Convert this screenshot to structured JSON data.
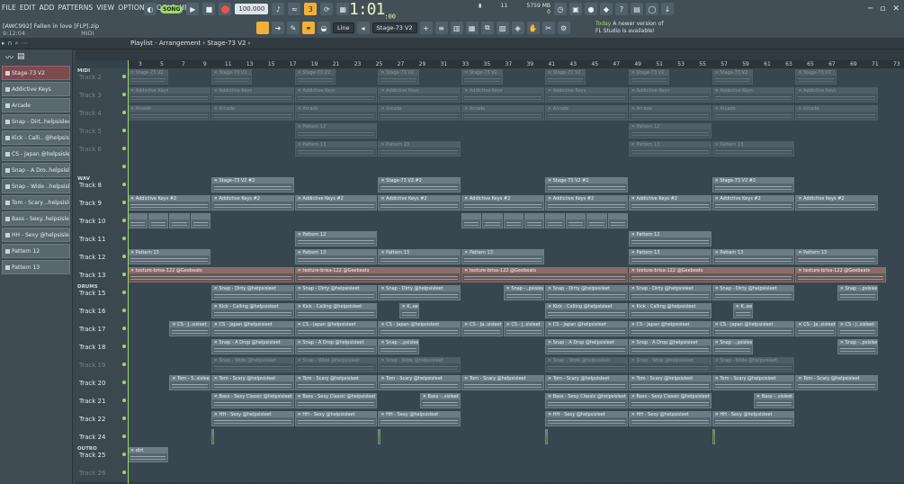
{
  "menu": [
    "FILE",
    "EDIT",
    "ADD",
    "PATTERNS",
    "VIEW",
    "OPTIONS",
    "TOOLS",
    "HELP"
  ],
  "project": {
    "name": "[AWC992] Fallen in love [FLP].zip",
    "time": "9:12:04",
    "midi": "MIDI"
  },
  "transport": {
    "song_label": "SONG",
    "tempo": "100.000",
    "clock": "1:01",
    "clock_sub": ":00"
  },
  "cpu": {
    "voices": "11",
    "mem": "5759 MB",
    "zero": "0"
  },
  "news": {
    "day": "Today",
    "line1": "A newer version of",
    "line2": "FL Studio is available!"
  },
  "snap": {
    "mode": "Line",
    "pattern": "Stage-73 V2"
  },
  "breadcrumb": "Playlist - Arrangement › Stage-73 V2 ›",
  "browser": {
    "header_icon": "wave-icon",
    "items": [
      {
        "label": "Stage-73 V2",
        "selected": true
      },
      {
        "label": "Addictive Keys",
        "selected": false
      },
      {
        "label": "Arcade",
        "selected": false
      },
      {
        "label": "Snap - Dirt..helpsisleet",
        "selected": false
      },
      {
        "label": "Kick - Calli.. @helpsisleet",
        "selected": false
      },
      {
        "label": "CS - Japan @helpsisleet",
        "selected": false
      },
      {
        "label": "Snap - A Dro..helpsisleet",
        "selected": false
      },
      {
        "label": "Snap - Wide ..helpsisleet",
        "selected": false
      },
      {
        "label": "Tom - Scary ..helpsisleet",
        "selected": false
      },
      {
        "label": "Bass - Sexy..helpsisleet",
        "selected": false
      },
      {
        "label": "HH - Sexy @helpsisleet",
        "selected": false
      },
      {
        "label": "Pattern 12",
        "selected": false
      },
      {
        "label": "Pattern 13",
        "selected": false
      }
    ]
  },
  "ruler": [
    "3",
    "5",
    "7",
    "9",
    "11",
    "13",
    "15",
    "17",
    "19",
    "21",
    "23",
    "25",
    "27",
    "29",
    "31",
    "33",
    "35",
    "37",
    "39",
    "41",
    "43",
    "45",
    "47",
    "49",
    "51",
    "53",
    "55",
    "57",
    "59",
    "61",
    "63",
    "65",
    "67",
    "69",
    "71",
    "73"
  ],
  "groups": [
    {
      "label": "MIDI",
      "row": 0
    },
    {
      "label": "WAV",
      "row": 6
    },
    {
      "label": "DRUMS",
      "row": 12
    },
    {
      "label": "OUTRO",
      "row": 21
    }
  ],
  "tracks": [
    {
      "name": "Track 2",
      "dim": true,
      "clips": [
        {
          "s": 0,
          "e": 1,
          "n": "Stage-73 V2"
        },
        {
          "s": 2,
          "e": 3,
          "n": "Stage-73 V2"
        },
        {
          "s": 4,
          "e": 5,
          "n": "Stage-73 V2"
        },
        {
          "s": 6,
          "e": 7,
          "n": "Stage-73 V2"
        },
        {
          "s": 8,
          "e": 9,
          "n": "Stage-73 V2"
        },
        {
          "s": 10,
          "e": 11,
          "n": "Stage-73 V2"
        },
        {
          "s": 12,
          "e": 13,
          "n": "Stage-73 V2"
        },
        {
          "s": 14,
          "e": 15,
          "n": "Stage-73 V2"
        },
        {
          "s": 16,
          "e": 17,
          "n": "Stage-73 V2"
        }
      ]
    },
    {
      "name": "Track 3",
      "dim": true,
      "clips": [
        {
          "s": 0,
          "e": 2,
          "n": "Addictive Keys"
        },
        {
          "s": 2,
          "e": 4,
          "n": "Addictive Keys"
        },
        {
          "s": 4,
          "e": 6,
          "n": "Addictive Keys"
        },
        {
          "s": 6,
          "e": 8,
          "n": "Addictive Keys"
        },
        {
          "s": 8,
          "e": 10,
          "n": "Addictive Keys"
        },
        {
          "s": 10,
          "e": 12,
          "n": "Addictive Keys"
        },
        {
          "s": 12,
          "e": 14,
          "n": "Addictive Keys"
        },
        {
          "s": 14,
          "e": 16,
          "n": "Addictive Keys"
        },
        {
          "s": 16,
          "e": 18,
          "n": "Addictive Keys"
        }
      ]
    },
    {
      "name": "Track 4",
      "dim": true,
      "clips": [
        {
          "s": 0,
          "e": 2,
          "n": "Arcade"
        },
        {
          "s": 2,
          "e": 4,
          "n": "Arcade"
        },
        {
          "s": 4,
          "e": 6,
          "n": "Arcade"
        },
        {
          "s": 6,
          "e": 8,
          "n": "Arcade"
        },
        {
          "s": 8,
          "e": 10,
          "n": "Arcade"
        },
        {
          "s": 10,
          "e": 12,
          "n": "Arcade"
        },
        {
          "s": 12,
          "e": 14,
          "n": "Arcade"
        },
        {
          "s": 14,
          "e": 16,
          "n": "Arcade"
        },
        {
          "s": 16,
          "e": 18,
          "n": "Arcade"
        }
      ]
    },
    {
      "name": "Track 5",
      "dim": true,
      "clips": [
        {
          "s": 4,
          "e": 6,
          "n": "Pattern 12"
        },
        {
          "s": 12,
          "e": 14,
          "n": "Pattern 12"
        }
      ]
    },
    {
      "name": "Track 6",
      "dim": true,
      "clips": [
        {
          "s": 4,
          "e": 6,
          "n": "Pattern 13"
        },
        {
          "s": 6,
          "e": 8,
          "n": "Pattern 13"
        },
        {
          "s": 12,
          "e": 14,
          "n": "Pattern 13"
        },
        {
          "s": 14,
          "e": 16,
          "n": "Pattern 13"
        }
      ]
    },
    {
      "name": "",
      "dim": true,
      "clips": []
    },
    {
      "name": "Track 8",
      "dim": false,
      "clips": [
        {
          "s": 2,
          "e": 4,
          "n": "Stage-73 V2 #2"
        },
        {
          "s": 6,
          "e": 8,
          "n": "Stage-73 V2 #2"
        },
        {
          "s": 10,
          "e": 12,
          "n": "Stage-73 V2 #2"
        },
        {
          "s": 14,
          "e": 16,
          "n": "Stage-73 V2 #2"
        }
      ]
    },
    {
      "name": "Track 9",
      "dim": false,
      "clips": [
        {
          "s": 0,
          "e": 2,
          "n": "Addictive Keys #2"
        },
        {
          "s": 2,
          "e": 4,
          "n": "Addictive Keys #2"
        },
        {
          "s": 4,
          "e": 6,
          "n": "Addictive Keys #2"
        },
        {
          "s": 6,
          "e": 8,
          "n": "Addictive Keys #2"
        },
        {
          "s": 8,
          "e": 10,
          "n": "Addictive Keys #2"
        },
        {
          "s": 10,
          "e": 12,
          "n": "Addictive Keys #2"
        },
        {
          "s": 12,
          "e": 14,
          "n": "Addictive Keys #2"
        },
        {
          "s": 14,
          "e": 16,
          "n": "Addictive Keys #2"
        },
        {
          "s": 16,
          "e": 18,
          "n": "Addictive Keys #2"
        }
      ]
    },
    {
      "name": "Track 10",
      "dim": false,
      "clips": [
        {
          "s": 0,
          "e": 0.5,
          "n": ""
        },
        {
          "s": 0.5,
          "e": 1,
          "n": ""
        },
        {
          "s": 1,
          "e": 1.5,
          "n": ""
        },
        {
          "s": 1.5,
          "e": 2,
          "n": ""
        },
        {
          "s": 8,
          "e": 8.5,
          "n": ""
        },
        {
          "s": 8.5,
          "e": 9,
          "n": ""
        },
        {
          "s": 9,
          "e": 9.5,
          "n": ""
        },
        {
          "s": 9.5,
          "e": 10,
          "n": ""
        },
        {
          "s": 10,
          "e": 10.5,
          "n": ""
        },
        {
          "s": 10.5,
          "e": 11,
          "n": ""
        },
        {
          "s": 11,
          "e": 11.5,
          "n": ""
        },
        {
          "s": 11.5,
          "e": 12,
          "n": ""
        }
      ]
    },
    {
      "name": "Track 11",
      "dim": false,
      "clips": [
        {
          "s": 4,
          "e": 6,
          "n": "Pattern 12"
        },
        {
          "s": 12,
          "e": 14,
          "n": "Pattern 12"
        }
      ]
    },
    {
      "name": "Track 12",
      "dim": false,
      "clips": [
        {
          "s": 0,
          "e": 2,
          "n": "Pattern 13"
        },
        {
          "s": 4,
          "e": 6,
          "n": "Pattern 13"
        },
        {
          "s": 6,
          "e": 8,
          "n": "Pattern 13"
        },
        {
          "s": 8,
          "e": 10,
          "n": "Pattern 13"
        },
        {
          "s": 12,
          "e": 14,
          "n": "Pattern 13"
        },
        {
          "s": 14,
          "e": 16,
          "n": "Pattern 13"
        },
        {
          "s": 16,
          "e": 18,
          "n": "Pattern 13"
        }
      ]
    },
    {
      "name": "Track 13",
      "dim": false,
      "clips": [
        {
          "s": 0,
          "e": 4,
          "n": "texture-brisa-122 @Geebeats",
          "c": "brown"
        },
        {
          "s": 4,
          "e": 8,
          "n": "texture-brisa-122 @Geebeats",
          "c": "brown"
        },
        {
          "s": 8,
          "e": 12,
          "n": "texture-brisa-122 @Geebeats",
          "c": "brown"
        },
        {
          "s": 12,
          "e": 16,
          "n": "texture-brisa-122 @Geebeats",
          "c": "brown"
        },
        {
          "s": 16,
          "e": 18.2,
          "n": "texture-brisa-122 @Geebeats",
          "c": "brown"
        }
      ]
    },
    {
      "name": "Track 15",
      "dim": false,
      "clips": [
        {
          "s": 2,
          "e": 4,
          "n": "Snap - Dirty @helpsisleet"
        },
        {
          "s": 4,
          "e": 6,
          "n": "Snap - Dirty @helpsisleet"
        },
        {
          "s": 6,
          "e": 8,
          "n": "Snap - Dirty @helpsisleet"
        },
        {
          "s": 9,
          "e": 10,
          "n": "Snap -..psisleet"
        },
        {
          "s": 10,
          "e": 12,
          "n": "Snap - Dirty @helpsisleet"
        },
        {
          "s": 12,
          "e": 14,
          "n": "Snap - Dirty @helpsisleet"
        },
        {
          "s": 14,
          "e": 16,
          "n": "Snap - Dirty @helpsisleet"
        },
        {
          "s": 17,
          "e": 18,
          "n": "Snap -..psisleet"
        }
      ]
    },
    {
      "name": "Track 16",
      "dim": false,
      "clips": [
        {
          "s": 2,
          "e": 4,
          "n": "Kick - Calling @helpsisleet"
        },
        {
          "s": 4,
          "e": 6,
          "n": "Kick - Calling @helpsisleet"
        },
        {
          "s": 6.5,
          "e": 7,
          "n": "K..eet"
        },
        {
          "s": 10,
          "e": 12,
          "n": "Kick - Calling @helpsisleet"
        },
        {
          "s": 12,
          "e": 14,
          "n": "Kick - Calling @helpsisleet"
        },
        {
          "s": 14.5,
          "e": 15,
          "n": "K..eet"
        }
      ]
    },
    {
      "name": "Track 17",
      "dim": false,
      "clips": [
        {
          "s": 1,
          "e": 2,
          "n": "CS - J..sisleet"
        },
        {
          "s": 2,
          "e": 4,
          "n": "CS - Japan @helpsisleet"
        },
        {
          "s": 4,
          "e": 6,
          "n": "CS - Japan @helpsisleet"
        },
        {
          "s": 6,
          "e": 8,
          "n": "CS - Japan @helpsisleet"
        },
        {
          "s": 8,
          "e": 9,
          "n": "CS - Ja..sisleet"
        },
        {
          "s": 9,
          "e": 10,
          "n": "CS - J..sisleet"
        },
        {
          "s": 10,
          "e": 12,
          "n": "CS - Japan @helpsisleet"
        },
        {
          "s": 12,
          "e": 14,
          "n": "CS - Japan @helpsisleet"
        },
        {
          "s": 14,
          "e": 16,
          "n": "CS - Japan @helpsisleet"
        },
        {
          "s": 16,
          "e": 17,
          "n": "CS - Ja..sisleet"
        },
        {
          "s": 17,
          "e": 18,
          "n": "CS - J..sisleet"
        }
      ]
    },
    {
      "name": "Track 18",
      "dim": false,
      "clips": [
        {
          "s": 2,
          "e": 4,
          "n": "Snap - A Drop @helpsisleet"
        },
        {
          "s": 4,
          "e": 6,
          "n": "Snap - A Drop @helpsisleet"
        },
        {
          "s": 6,
          "e": 7,
          "n": "Snap -..psisleet"
        },
        {
          "s": 10,
          "e": 12,
          "n": "Snap - A Drop @helpsisleet"
        },
        {
          "s": 12,
          "e": 14,
          "n": "Snap - A Drop @helpsisleet"
        },
        {
          "s": 14,
          "e": 15,
          "n": "Snap -..psisleet"
        },
        {
          "s": 17,
          "e": 18,
          "n": "Snap -..psisleet"
        }
      ]
    },
    {
      "name": "Track 19",
      "dim": true,
      "clips": [
        {
          "s": 2,
          "e": 4,
          "n": "Snap - Wide @helpsisleet",
          "c": "dim"
        },
        {
          "s": 4,
          "e": 6,
          "n": "Snap - Wide @helpsisleet",
          "c": "dim"
        },
        {
          "s": 6,
          "e": 8,
          "n": "Snap - Wide @helpsisleet",
          "c": "dim"
        },
        {
          "s": 10,
          "e": 12,
          "n": "Snap - Wide @helpsisleet",
          "c": "dim"
        },
        {
          "s": 12,
          "e": 14,
          "n": "Snap - Wide @helpsisleet",
          "c": "dim"
        },
        {
          "s": 14,
          "e": 16,
          "n": "Snap - Wide @helpsisleet",
          "c": "dim"
        }
      ]
    },
    {
      "name": "Track 20",
      "dim": false,
      "clips": [
        {
          "s": 1,
          "e": 2,
          "n": "Tom - S..sisleet"
        },
        {
          "s": 2,
          "e": 4,
          "n": "Tom - Scary @helpsisleet"
        },
        {
          "s": 4,
          "e": 6,
          "n": "Tom - Scary @helpsisleet"
        },
        {
          "s": 6,
          "e": 8,
          "n": "Tom - Scary @helpsisleet"
        },
        {
          "s": 8,
          "e": 10,
          "n": "Tom - Scary @helpsisleet"
        },
        {
          "s": 10,
          "e": 12,
          "n": "Tom - Scary @helpsisleet"
        },
        {
          "s": 12,
          "e": 14,
          "n": "Tom - Scary @helpsisleet"
        },
        {
          "s": 14,
          "e": 16,
          "n": "Tom - Scary @helpsisleet"
        },
        {
          "s": 16,
          "e": 18,
          "n": "Tom - Scary @helpsisleet"
        }
      ]
    },
    {
      "name": "Track 21",
      "dim": false,
      "clips": [
        {
          "s": 2,
          "e": 4,
          "n": "Bass - Sexy Classic @helpsisleet"
        },
        {
          "s": 4,
          "e": 6,
          "n": "Bass - Sexy Classic @helpsisleet"
        },
        {
          "s": 7,
          "e": 8,
          "n": "Bass -..sisleet"
        },
        {
          "s": 10,
          "e": 12,
          "n": "Bass - Sexy Classic @helpsisleet"
        },
        {
          "s": 12,
          "e": 14,
          "n": "Bass - Sexy Classic @helpsisleet"
        },
        {
          "s": 15,
          "e": 16,
          "n": "Bass -..sisleet"
        }
      ]
    },
    {
      "name": "Track 22",
      "dim": false,
      "clips": [
        {
          "s": 2,
          "e": 4,
          "n": "HH - Sexy @helpsisleet"
        },
        {
          "s": 4,
          "e": 6,
          "n": "HH - Sexy @helpsisleet"
        },
        {
          "s": 6,
          "e": 8,
          "n": "HH - Sexy @helpsisleet"
        },
        {
          "s": 10,
          "e": 12,
          "n": "HH - Sexy @helpsisleet"
        },
        {
          "s": 12,
          "e": 14,
          "n": "HH - Sexy @helpsisleet"
        },
        {
          "s": 14,
          "e": 16,
          "n": "HH - Sexy @helpsisleet"
        }
      ]
    },
    {
      "name": "Track 24",
      "dim": false,
      "clips": [
        {
          "s": 2,
          "e": 2.05,
          "n": "",
          "c": "green"
        },
        {
          "s": 6,
          "e": 6.05,
          "n": "",
          "c": "green"
        },
        {
          "s": 10,
          "e": 10.05,
          "n": "",
          "c": "green"
        },
        {
          "s": 14,
          "e": 14.05,
          "n": "",
          "c": "green"
        }
      ]
    },
    {
      "name": "Track 25",
      "dim": false,
      "clips": [
        {
          "s": 0,
          "e": 1,
          "n": "dirt"
        }
      ]
    },
    {
      "name": "Track 26",
      "dim": true,
      "clips": []
    }
  ]
}
